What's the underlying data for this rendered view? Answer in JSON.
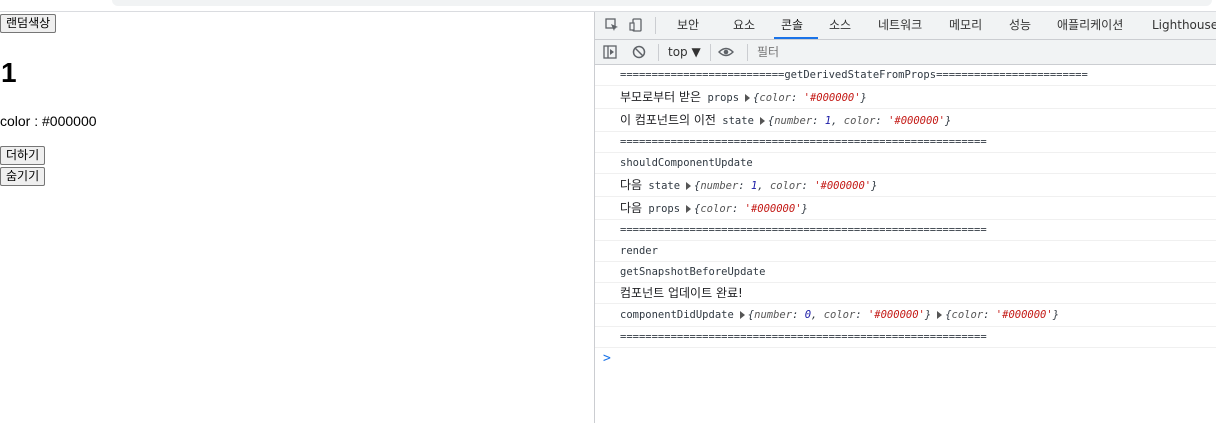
{
  "page": {
    "random_color_button": "랜덤색상",
    "number": "1",
    "color_text": "color : #000000",
    "add_button": "더하기",
    "hide_button": "숨기기"
  },
  "devtools": {
    "tabs": [
      "보안",
      "요소",
      "콘솔",
      "소스",
      "네트워크",
      "메모리",
      "성능",
      "애플리케이션",
      "Lighthouse"
    ],
    "active_tab": "콘솔",
    "context": "top ▼",
    "filter_placeholder": "필터",
    "accent_color": "#1a73e8",
    "icons": [
      "inspect-icon",
      "device-toggle-icon",
      "sidebar-toggle-icon",
      "clear-console-icon",
      "eye-icon"
    ]
  },
  "console": {
    "line1": "==========================getDerivedStateFromProps========================",
    "line2_label": "부모로부터 받은",
    "line2_mono": "props",
    "line2_obj": {
      "k1": "color",
      "v1": "'#000000'"
    },
    "line3_label": "이 컴포넌트의 이전",
    "line3_mono": "state",
    "line3_obj": {
      "k1": "number",
      "v1": "1",
      "k2": "color",
      "v2": "'#000000'"
    },
    "line4": "==========================================================",
    "line5": "shouldComponentUpdate",
    "line6_label": "다음",
    "line6_mono": "state",
    "line6_obj": {
      "k1": "number",
      "v1": "1",
      "k2": "color",
      "v2": "'#000000'"
    },
    "line7_label": "다음",
    "line7_mono": "props",
    "line7_obj": {
      "k1": "color",
      "v1": "'#000000'"
    },
    "line8": "==========================================================",
    "line9": "render",
    "line10": "getSnapshotBeforeUpdate",
    "line11": "컴포넌트 업데이트 완료!",
    "line12_mono": "componentDidUpdate",
    "line12_obj1": {
      "k1": "number",
      "v1": "0",
      "k2": "color",
      "v2": "'#000000'"
    },
    "line12_obj2": {
      "k1": "color",
      "v1": "'#000000'"
    },
    "line13": "==========================================================",
    "prompt": ">"
  }
}
